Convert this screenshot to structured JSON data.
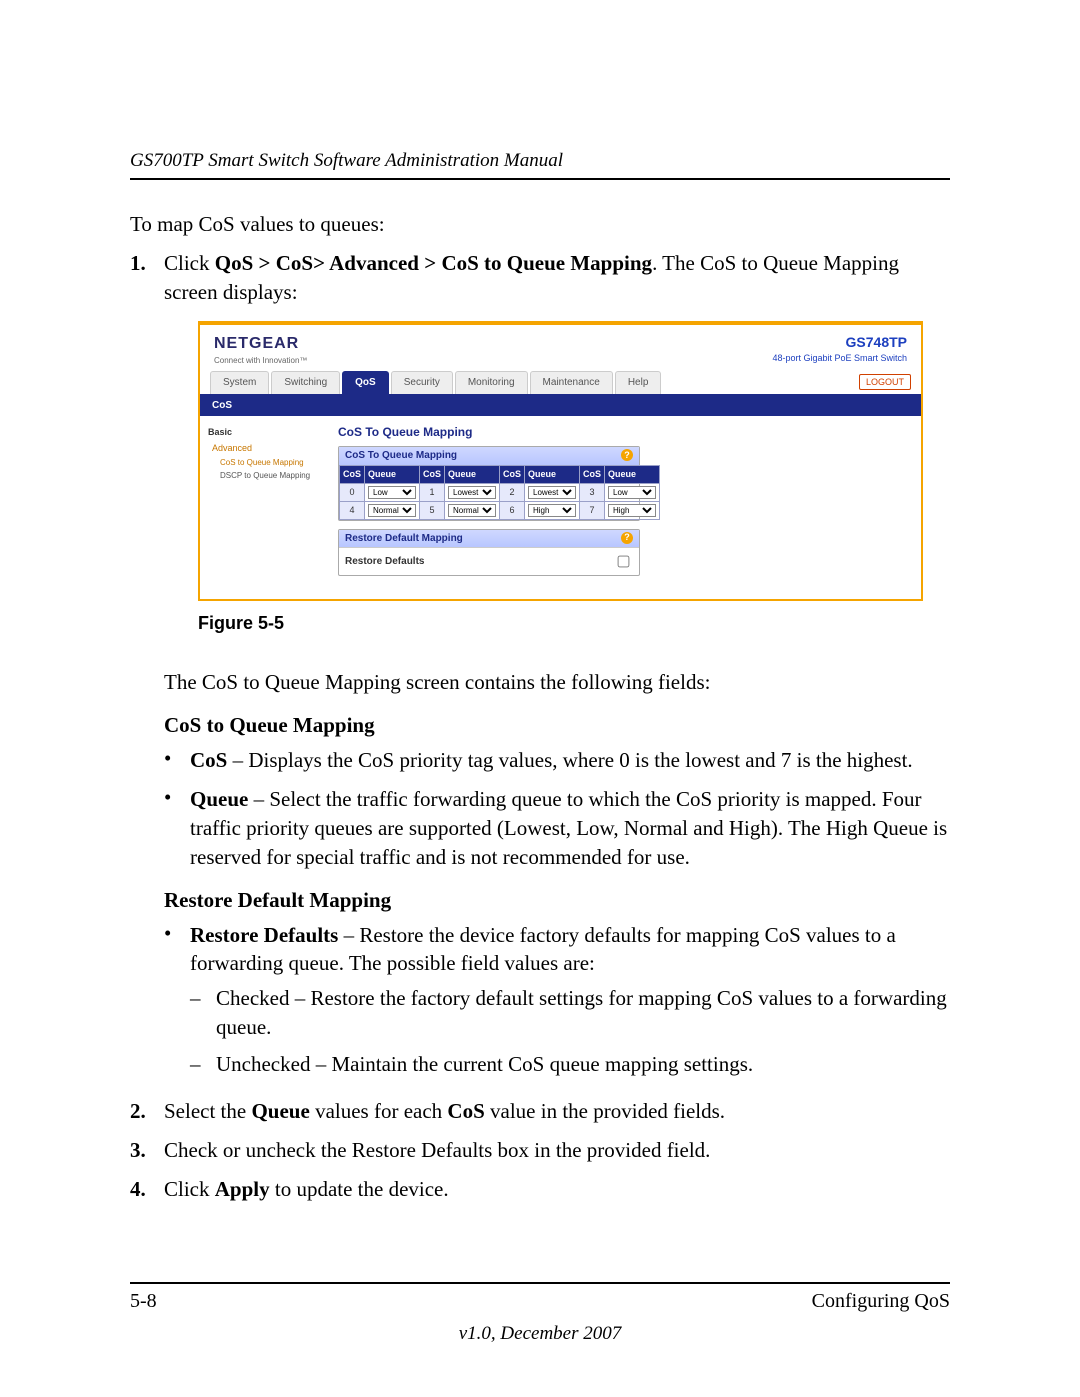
{
  "doc": {
    "running_head": "GS700TP Smart Switch Software Administration Manual",
    "intro": "To map CoS values to queues:",
    "step1_prefix": "Click ",
    "step1_path": "QoS > CoS> Advanced > CoS to Queue Mapping",
    "step1_suffix": ". The CoS to Queue Mapping screen displays:",
    "figure_caption": "Figure 5-5",
    "after_figure": "The CoS to Queue Mapping screen contains the following fields:",
    "section1_title": "CoS to Queue Mapping",
    "bullet_cos_label": "CoS",
    "bullet_cos_text": " – Displays the CoS priority tag values, where 0 is the lowest and 7 is the highest.",
    "bullet_queue_label": "Queue",
    "bullet_queue_text": " – Select the traffic forwarding queue to which the CoS priority is mapped. Four traffic priority queues are supported (Lowest, Low, Normal and High). The High Queue is reserved for special traffic and is not recommended for use.",
    "section2_title": "Restore Default Mapping",
    "bullet_restore_label": "Restore Defaults",
    "bullet_restore_text": " – Restore the device factory defaults for mapping CoS values to a forwarding queue. The possible field values are:",
    "dash_checked": "Checked – Restore the factory default settings for mapping CoS values to a forwarding queue.",
    "dash_unchecked": "Unchecked – Maintain the current CoS queue mapping settings.",
    "step2_a": "Select the ",
    "step2_b": "Queue",
    "step2_c": " values for each ",
    "step2_d": "CoS",
    "step2_e": " value in the provided fields.",
    "step3": "Check or uncheck the Restore Defaults box in the provided field.",
    "step4_a": "Click ",
    "step4_b": "Apply",
    "step4_c": " to update the device.",
    "page_num": "5-8",
    "footer_section": "Configuring QoS",
    "version_line": "v1.0, December 2007"
  },
  "shot": {
    "brand": "NETGEAR",
    "brand_sub": "Connect with Innovation™",
    "model": "GS748TP",
    "model_sub": "48-port Gigabit PoE Smart Switch",
    "tabs": [
      "System",
      "Switching",
      "QoS",
      "Security",
      "Monitoring",
      "Maintenance",
      "Help"
    ],
    "active_tab_index": 2,
    "logout": "LOGOUT",
    "subtab": "CoS",
    "sidebar": {
      "basic": "Basic",
      "advanced": "Advanced",
      "cos_to_queue": "CoS to Queue Mapping",
      "dscp_to_queue": "DSCP to Queue Mapping"
    },
    "main_title": "CoS To Queue Mapping",
    "panel1_title": "CoS To Queue Mapping",
    "col_cos": "CoS",
    "col_queue": "Queue",
    "rows": [
      {
        "cos": "0",
        "queue": "Low"
      },
      {
        "cos": "1",
        "queue": "Lowest"
      },
      {
        "cos": "2",
        "queue": "Lowest"
      },
      {
        "cos": "3",
        "queue": "Low"
      },
      {
        "cos": "4",
        "queue": "Normal"
      },
      {
        "cos": "5",
        "queue": "Normal"
      },
      {
        "cos": "6",
        "queue": "High"
      },
      {
        "cos": "7",
        "queue": "High"
      }
    ],
    "queue_options": [
      "Lowest",
      "Low",
      "Normal",
      "High"
    ],
    "panel2_title": "Restore Default Mapping",
    "restore_label": "Restore Defaults",
    "help_glyph": "?"
  }
}
